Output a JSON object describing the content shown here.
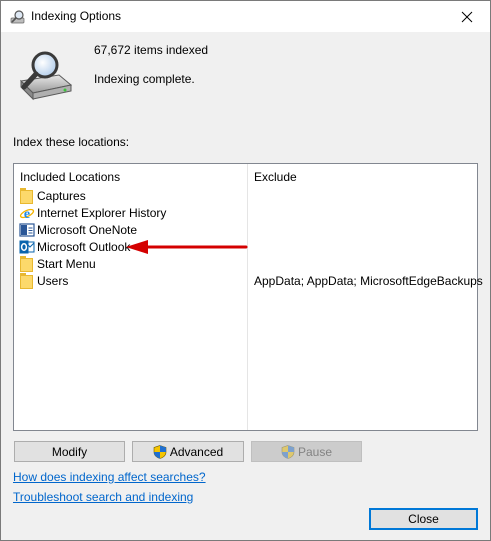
{
  "window": {
    "title": "Indexing Options"
  },
  "status": {
    "items_indexed": "67,672 items indexed",
    "state": "Indexing complete."
  },
  "index_label": "Index these locations:",
  "table": {
    "headers": [
      "Included Locations",
      "Exclude"
    ],
    "rows": [
      {
        "name": "Captures",
        "icon": "folder-icon",
        "exclude": ""
      },
      {
        "name": "Internet Explorer History",
        "icon": "internet-explorer-icon",
        "exclude": ""
      },
      {
        "name": "Microsoft OneNote",
        "icon": "onenote-icon",
        "exclude": ""
      },
      {
        "name": "Microsoft Outlook",
        "icon": "outlook-icon",
        "exclude": ""
      },
      {
        "name": "Start Menu",
        "icon": "folder-icon",
        "exclude": ""
      },
      {
        "name": "Users",
        "icon": "folder-icon",
        "exclude": "AppData; AppData; MicrosoftEdgeBackups"
      }
    ]
  },
  "buttons": {
    "modify": "Modify",
    "advanced": "Advanced",
    "pause": "Pause",
    "close": "Close"
  },
  "links": {
    "how_affect": "How does indexing affect searches?",
    "troubleshoot": "Troubleshoot search and indexing"
  },
  "colors": {
    "annotation_arrow": "#d40000",
    "link": "#0066cc",
    "focus_border": "#0078d7"
  }
}
